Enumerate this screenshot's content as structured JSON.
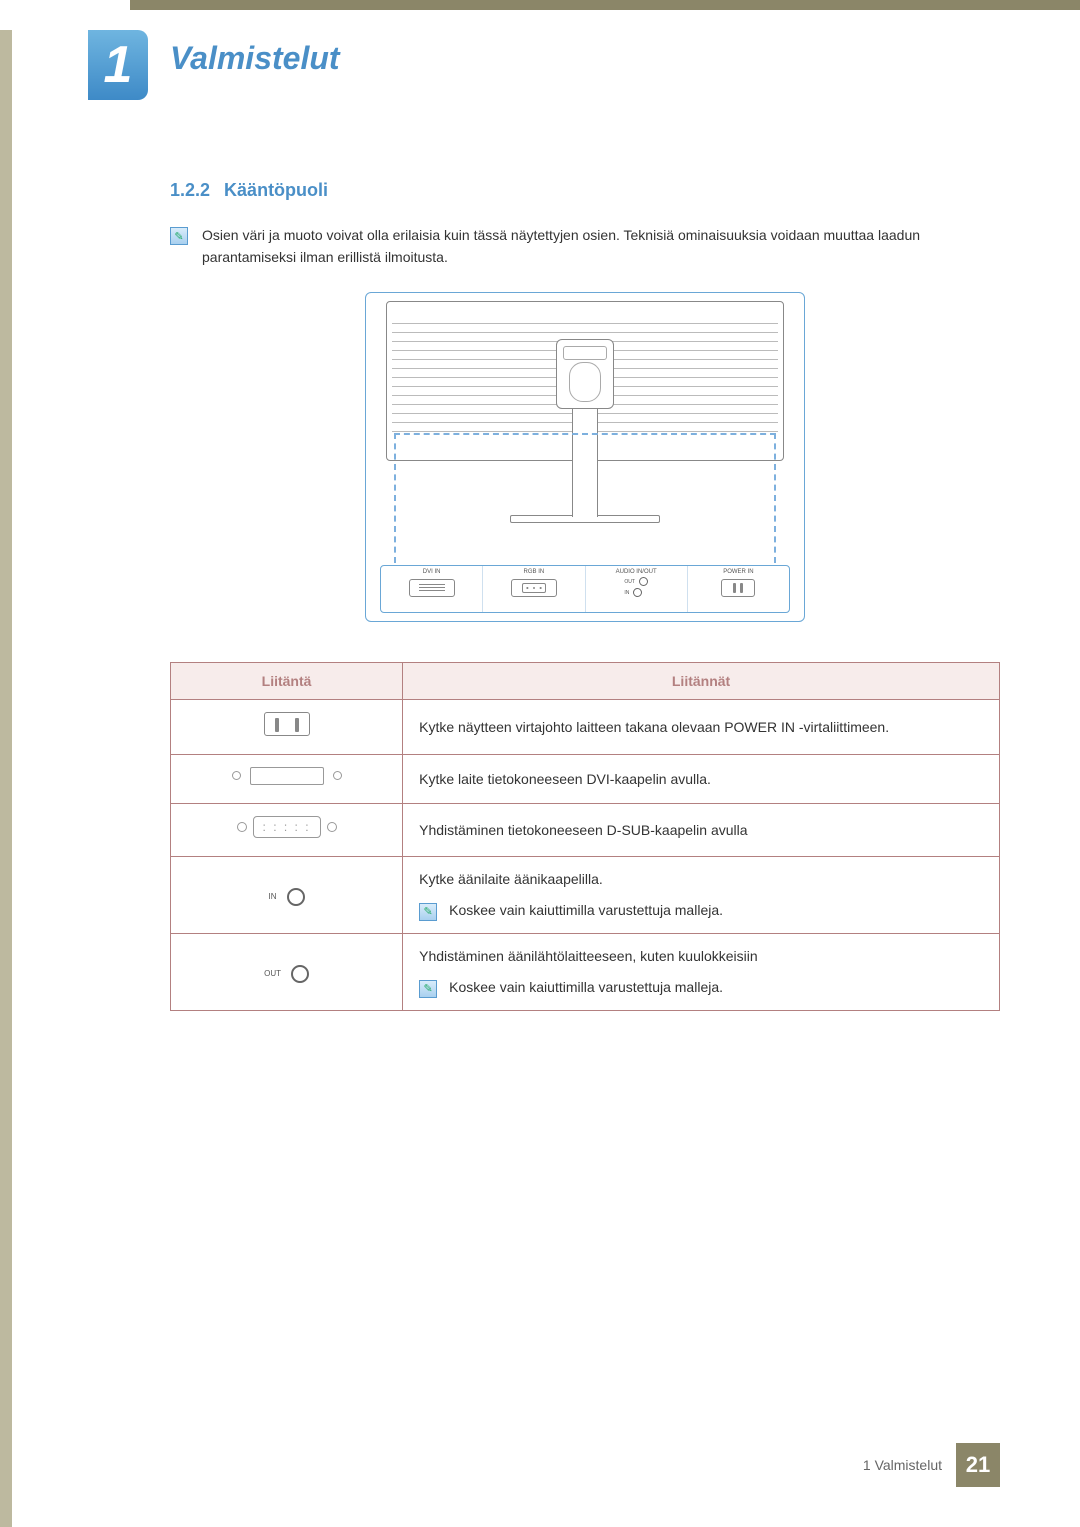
{
  "chapter": {
    "number": "1",
    "title": "Valmistelut"
  },
  "subsection": {
    "number": "1.2.2",
    "title": "Kääntöpuoli"
  },
  "note": "Osien väri ja muoto voivat olla erilaisia kuin tässä näytettyjen osien. Teknisiä ominaisuuksia voidaan muuttaa laadun parantamiseksi ilman erillistä ilmoitusta.",
  "diagram_labels": {
    "dvi": "DVI IN",
    "rgb": "RGB IN",
    "audio": "AUDIO IN/OUT",
    "audio_out": "OUT",
    "audio_in": "IN",
    "power": "POWER IN"
  },
  "table": {
    "header_port": "Liitäntä",
    "header_desc": "Liitännät",
    "rows": [
      {
        "icon": "power",
        "desc": "Kytke näytteen virtajohto laitteen takana olevaan POWER IN -virtaliittimeen."
      },
      {
        "icon": "dvi",
        "desc": "Kytke laite tietokoneeseen DVI-kaapelin avulla."
      },
      {
        "icon": "rgb",
        "desc": "Yhdistäminen tietokoneeseen D-SUB-kaapelin avulla"
      },
      {
        "icon": "audio_in",
        "label": "IN",
        "desc": "Kytke äänilaite äänikaapelilla.",
        "subnote": "Koskee vain kaiuttimilla varustettuja malleja."
      },
      {
        "icon": "audio_out",
        "label": "OUT",
        "desc": "Yhdistäminen äänilähtölaitteeseen, kuten kuulokkeisiin",
        "subnote": "Koskee vain kaiuttimilla varustettuja malleja."
      }
    ]
  },
  "footer": {
    "chapter_label": "1 Valmistelut",
    "page_number": "21"
  }
}
